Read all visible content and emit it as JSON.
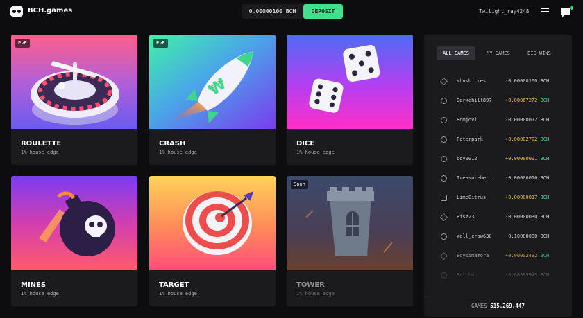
{
  "header": {
    "brand": "BCH.games",
    "balance": "0.00000100 BCH",
    "deposit_label": "DEPOSIT",
    "username": "Twilight_ray4248",
    "icons": [
      "logo-icon",
      "menu-icon",
      "chat-icon"
    ]
  },
  "games": [
    {
      "title": "ROULETTE",
      "edge": "1% house edge",
      "badge": "PvE"
    },
    {
      "title": "CRASH",
      "edge": "1% house edge",
      "badge": "PvE"
    },
    {
      "title": "DICE",
      "edge": "1% house edge",
      "badge": ""
    },
    {
      "title": "MINES",
      "edge": "1% house edge",
      "badge": ""
    },
    {
      "title": "TARGET",
      "edge": "1% house edge",
      "badge": ""
    },
    {
      "title": "TOWER",
      "edge": "1% house edge",
      "badge": "Soon"
    }
  ],
  "panel": {
    "tabs": [
      "ALL GAMES",
      "MY GAMES",
      "BIG WINS"
    ],
    "active_tab": "ALL GAMES",
    "bets": [
      {
        "player": "shushicres",
        "sign": "-",
        "amount": "0.00000100",
        "currency": "BCH",
        "icon": "diamond-icon"
      },
      {
        "player": "Darkchill897",
        "sign": "+",
        "amount": "0.00067272",
        "currency": "BCH",
        "icon": "rocket-icon"
      },
      {
        "player": "Bomjovi",
        "sign": "-",
        "amount": "0.00000012",
        "currency": "BCH",
        "icon": "target-icon"
      },
      {
        "player": "Peterpark",
        "sign": "+",
        "amount": "0.00002702",
        "currency": "BCH",
        "icon": "target-icon"
      },
      {
        "player": "boy0012",
        "sign": "+",
        "amount": "0.00000001",
        "currency": "BCH",
        "icon": "target-icon"
      },
      {
        "player": "Treasurebe...",
        "sign": "-",
        "amount": "0.00000016",
        "currency": "BCH",
        "icon": "target-icon"
      },
      {
        "player": "LimeCitrus",
        "sign": "+",
        "amount": "0.00000017",
        "currency": "BCH",
        "icon": "dice-icon"
      },
      {
        "player": "Risz23",
        "sign": "-",
        "amount": "0.00000030",
        "currency": "BCH",
        "icon": "diamond-icon"
      },
      {
        "player": "Well_crow630",
        "sign": "-",
        "amount": "0.10000000",
        "currency": "BCH",
        "icon": "target-icon"
      },
      {
        "player": "Boysimamora",
        "sign": "+",
        "amount": "0.00002432",
        "currency": "BCH",
        "icon": "diamond-icon"
      },
      {
        "player": "Botchu",
        "sign": "-",
        "amount": "0.00999943",
        "currency": "BCH",
        "icon": "target-icon"
      }
    ],
    "games_label": "GAMES",
    "games_count": "515,269,447"
  }
}
